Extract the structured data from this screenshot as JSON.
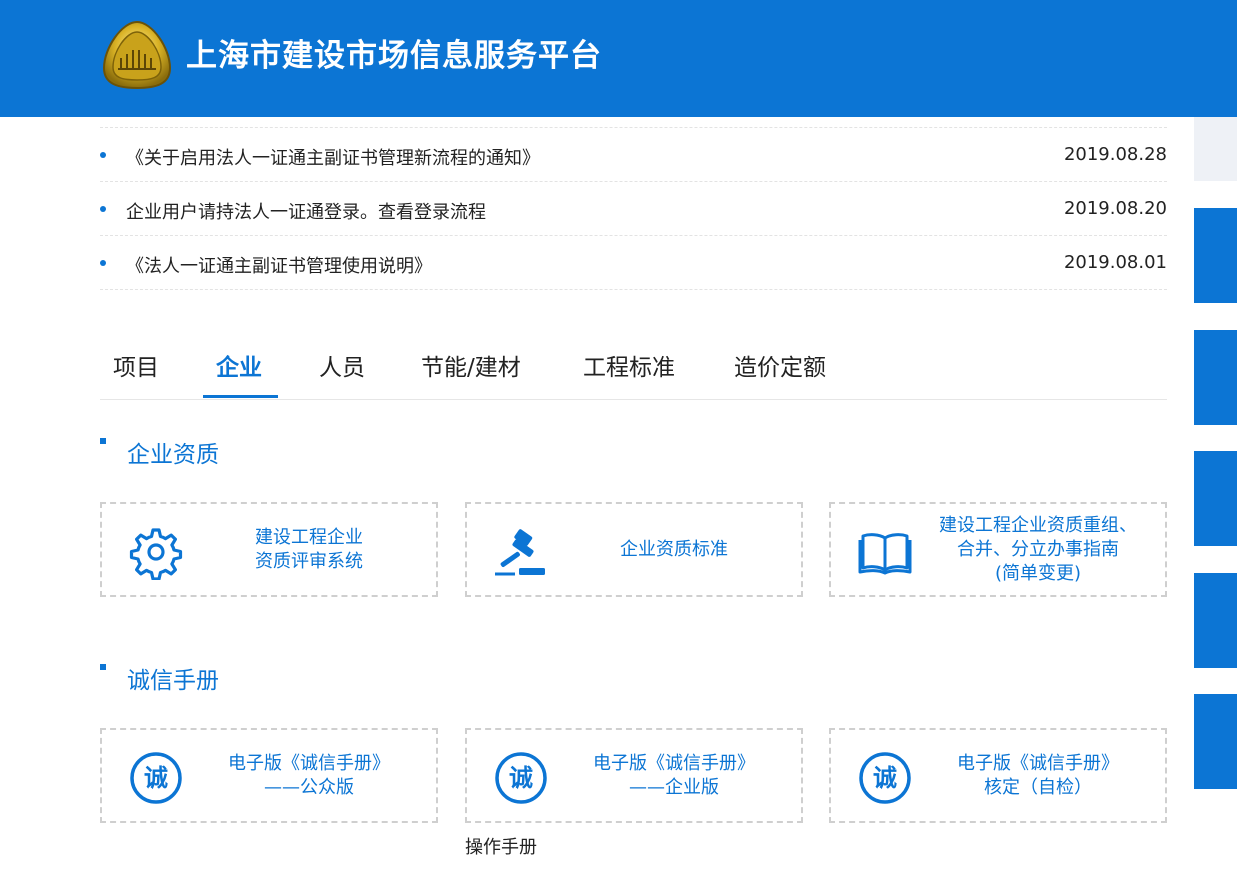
{
  "header": {
    "title": "上海市建设市场信息服务平台"
  },
  "news": [
    {
      "title": "《关于启用法人一证通主副证书管理新流程的通知》",
      "date": "2019.08.28"
    },
    {
      "title": "企业用户请持法人一证通登录。查看登录流程",
      "date": "2019.08.20"
    },
    {
      "title": "《法人一证通主副证书管理使用说明》",
      "date": "2019.08.01"
    }
  ],
  "tabs": [
    {
      "label": "项目",
      "active": false
    },
    {
      "label": "企业",
      "active": true
    },
    {
      "label": "人员",
      "active": false
    },
    {
      "label": "节能/建材",
      "active": false
    },
    {
      "label": "工程标准",
      "active": false
    },
    {
      "label": "造价定额",
      "active": false
    }
  ],
  "sections": [
    {
      "title": "企业资质",
      "cards": [
        {
          "icon": "gear-icon",
          "lines": [
            "建设工程企业",
            "资质评审系统"
          ]
        },
        {
          "icon": "gavel-icon",
          "lines": [
            "企业资质标准"
          ]
        },
        {
          "icon": "book-icon",
          "lines": [
            "建设工程企业资质重组、",
            "合并、分立办事指南",
            "(简单变更)"
          ]
        }
      ]
    },
    {
      "title": "诚信手册",
      "cards": [
        {
          "icon": "integrity-badge-icon",
          "badge": "诚",
          "lines": [
            "电子版《诚信手册》",
            "——公众版"
          ]
        },
        {
          "icon": "integrity-badge-icon",
          "badge": "诚",
          "lines": [
            "电子版《诚信手册》",
            "——企业版"
          ]
        },
        {
          "icon": "integrity-badge-icon",
          "badge": "诚",
          "lines": [
            "电子版《诚信手册》",
            "核定（自检）"
          ]
        }
      ]
    }
  ],
  "manual_link": "操作手册",
  "colors": {
    "brand": "#0c75d4",
    "border": "#cfcfcf"
  }
}
